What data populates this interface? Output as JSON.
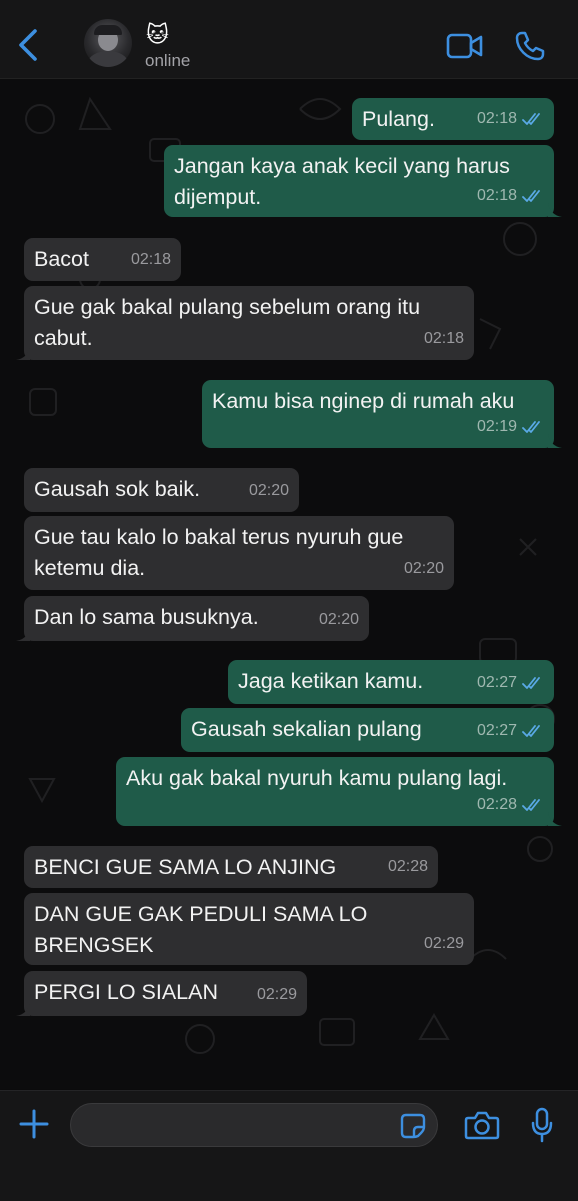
{
  "header": {
    "contact_emoji": "🐱",
    "status": "online",
    "icons": [
      "back-chevron-icon",
      "video-call-icon",
      "phone-icon"
    ],
    "accent_color": "#3d8fe0"
  },
  "messages": [
    {
      "dir": "out",
      "text": "Pulang.",
      "time": "02:18",
      "read": true
    },
    {
      "dir": "out",
      "text": "Jangan kaya anak kecil yang harus\ndijemput.",
      "time": "02:18",
      "read": true
    },
    {
      "dir": "in",
      "text": "Bacot",
      "time": "02:18"
    },
    {
      "dir": "in",
      "text": "Gue gak bakal pulang sebelum orang itu\ncabut.",
      "time": "02:18"
    },
    {
      "dir": "out",
      "text": "Kamu bisa nginep di rumah aku",
      "time": "02:19",
      "read": true
    },
    {
      "dir": "in",
      "text": "Gausah sok baik.",
      "time": "02:20"
    },
    {
      "dir": "in",
      "text": "Gue tau kalo lo bakal terus nyuruh gue\nketemu dia.",
      "time": "02:20"
    },
    {
      "dir": "in",
      "text": "Dan lo sama busuknya.",
      "time": "02:20"
    },
    {
      "dir": "out",
      "text": "Jaga ketikan kamu.",
      "time": "02:27",
      "read": true
    },
    {
      "dir": "out",
      "text": "Gausah sekalian pulang",
      "time": "02:27",
      "read": true
    },
    {
      "dir": "out",
      "text": "Aku gak bakal nyuruh kamu pulang lagi.",
      "time": "02:28",
      "read": true
    },
    {
      "dir": "in",
      "text": "BENCI GUE SAMA LO ANJING",
      "time": "02:28"
    },
    {
      "dir": "in",
      "text": "DAN GUE GAK PEDULI SAMA LO\nBRENGSEK",
      "time": "02:29"
    },
    {
      "dir": "in",
      "text": "PERGI LO SIALAN",
      "time": "02:29"
    }
  ],
  "colors": {
    "outgoing_bubble": "#1f5b49",
    "incoming_bubble": "#2e2e30",
    "read_ticks": "#5aa9e6"
  },
  "input_bar": {
    "message_value": "",
    "icons": [
      "plus-icon",
      "sticker-icon",
      "camera-icon",
      "microphone-icon"
    ]
  }
}
